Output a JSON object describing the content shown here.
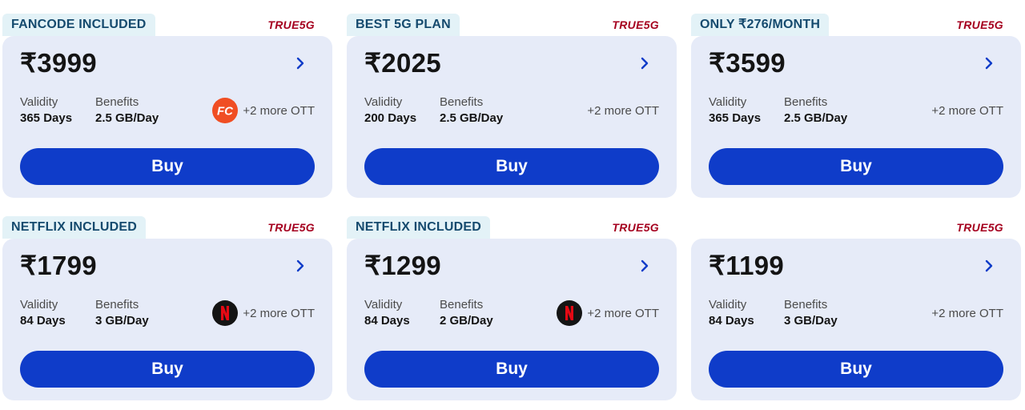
{
  "colors": {
    "tag_bg": "#e3f2f7",
    "card_bg": "#e6ebf8",
    "buy_bg": "#0f3cc9",
    "brand": "#a5001f"
  },
  "plans": [
    {
      "tag": "FANCODE INCLUDED",
      "brand": "TRUE5G",
      "price": "₹3999",
      "validity_label": "Validity",
      "validity": "365 Days",
      "benefits_label": "Benefits",
      "benefits": "2.5 GB/Day",
      "ott_logo": "fancode-icon",
      "ott_text": "+2 more OTT",
      "buy_label": "Buy"
    },
    {
      "tag": "BEST 5G PLAN",
      "brand": "TRUE5G",
      "price": "₹2025",
      "validity_label": "Validity",
      "validity": "200 Days",
      "benefits_label": "Benefits",
      "benefits": "2.5 GB/Day",
      "ott_logo": "",
      "ott_text": "+2 more OTT",
      "buy_label": "Buy"
    },
    {
      "tag": "ONLY ₹276/MONTH",
      "brand": "TRUE5G",
      "price": "₹3599",
      "validity_label": "Validity",
      "validity": "365 Days",
      "benefits_label": "Benefits",
      "benefits": "2.5 GB/Day",
      "ott_logo": "",
      "ott_text": "+2 more OTT",
      "buy_label": "Buy"
    },
    {
      "tag": "NETFLIX INCLUDED",
      "brand": "TRUE5G",
      "price": "₹1799",
      "validity_label": "Validity",
      "validity": "84 Days",
      "benefits_label": "Benefits",
      "benefits": "3 GB/Day",
      "ott_logo": "netflix-icon",
      "ott_text": "+2 more OTT",
      "buy_label": "Buy"
    },
    {
      "tag": "NETFLIX INCLUDED",
      "brand": "TRUE5G",
      "price": "₹1299",
      "validity_label": "Validity",
      "validity": "84 Days",
      "benefits_label": "Benefits",
      "benefits": "2 GB/Day",
      "ott_logo": "netflix-icon",
      "ott_text": "+2 more OTT",
      "buy_label": "Buy"
    },
    {
      "tag": "",
      "brand": "TRUE5G",
      "price": "₹1199",
      "validity_label": "Validity",
      "validity": "84 Days",
      "benefits_label": "Benefits",
      "benefits": "3 GB/Day",
      "ott_logo": "",
      "ott_text": "+2 more OTT",
      "buy_label": "Buy"
    }
  ]
}
